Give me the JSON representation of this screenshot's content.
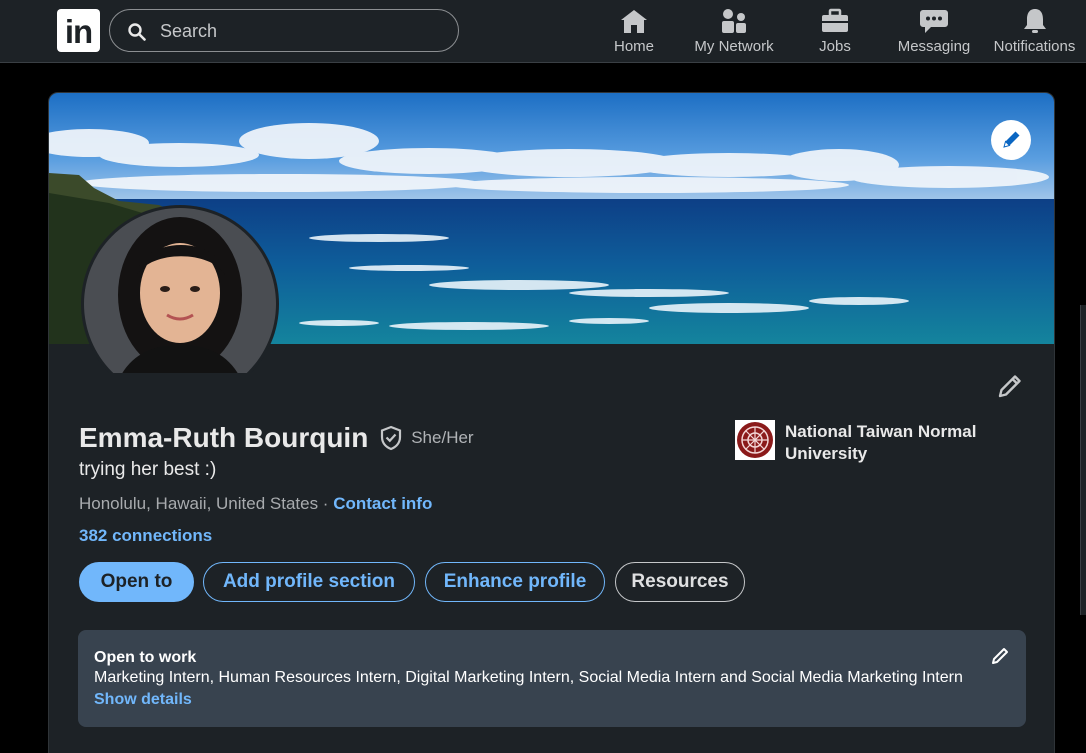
{
  "nav": {
    "logo_text": "in",
    "search_placeholder": "Search",
    "items": [
      {
        "label": "Home",
        "icon": "home-icon"
      },
      {
        "label": "My Network",
        "icon": "people-icon"
      },
      {
        "label": "Jobs",
        "icon": "briefcase-icon"
      },
      {
        "label": "Messaging",
        "icon": "chat-icon"
      },
      {
        "label": "Notifications",
        "icon": "bell-icon"
      }
    ]
  },
  "profile": {
    "name": "Emma-Ruth Bourquin",
    "pronouns": "She/Her",
    "headline": "trying her best :)",
    "location": "Honolulu, Hawaii, United States",
    "location_separator": " · ",
    "contact_info": "Contact info",
    "connections": "382 connections",
    "school": "National Taiwan Normal University"
  },
  "actions": {
    "open_to": "Open to",
    "add_section": "Add profile section",
    "enhance": "Enhance profile",
    "resources": "Resources"
  },
  "open_to_work": {
    "title": "Open to work",
    "roles": "Marketing Intern, Human Resources Intern, Digital Marketing Intern, Social Media Intern and Social Media Marketing Intern",
    "show_details": "Show details"
  },
  "colors": {
    "background": "#000000",
    "surface": "#1d2226",
    "accent": "#71b7fb",
    "card_secondary": "#38434f",
    "school_logo": "#8b1a1a"
  }
}
